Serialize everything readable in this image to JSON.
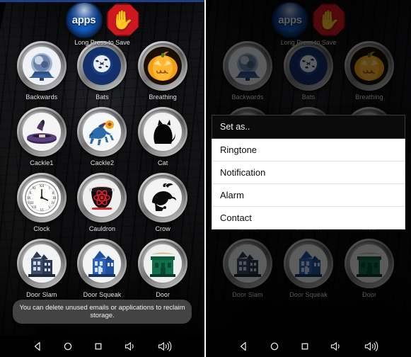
{
  "app": {
    "header_caption": "Long Press to Save",
    "apps_label": "apps",
    "stop_icon": "stop-hand-icon"
  },
  "sounds": [
    {
      "label": "Backwards",
      "icon": "backwards-orb-icon"
    },
    {
      "label": "Bats",
      "icon": "bats-moon-icon"
    },
    {
      "label": "Breathing",
      "icon": "pumpkin-icon"
    },
    {
      "label": "Cackle1",
      "icon": "witch-hat-icon"
    },
    {
      "label": "Cackle2",
      "icon": "headless-horseman-icon"
    },
    {
      "label": "Cat",
      "icon": "black-cat-icon"
    },
    {
      "label": "Clock",
      "icon": "clock-icon"
    },
    {
      "label": "Cauldron",
      "icon": "cauldron-icon"
    },
    {
      "label": "Crow",
      "icon": "crow-icon"
    },
    {
      "label": "Door Slam",
      "icon": "haunted-house-icon"
    },
    {
      "label": "Door Squeak",
      "icon": "blue-house-icon"
    },
    {
      "label": "Door",
      "icon": "green-house-icon"
    }
  ],
  "toast": {
    "message": "You can delete unused emails or applications to reclaim storage."
  },
  "navbar": [
    {
      "name": "back-icon"
    },
    {
      "name": "home-icon"
    },
    {
      "name": "recents-icon"
    },
    {
      "name": "volume-down-icon"
    },
    {
      "name": "volume-up-icon"
    }
  ],
  "dialog": {
    "title": "Set as..",
    "items": [
      "Ringtone",
      "Notification",
      "Alarm",
      "Contact"
    ]
  },
  "colors": {
    "statusbar": "#1e3f86",
    "apps_blue": "#1461c4",
    "stop_red": "#cf1720",
    "dialog_header": "#0b0b0b",
    "toast_bg": "#484848"
  }
}
